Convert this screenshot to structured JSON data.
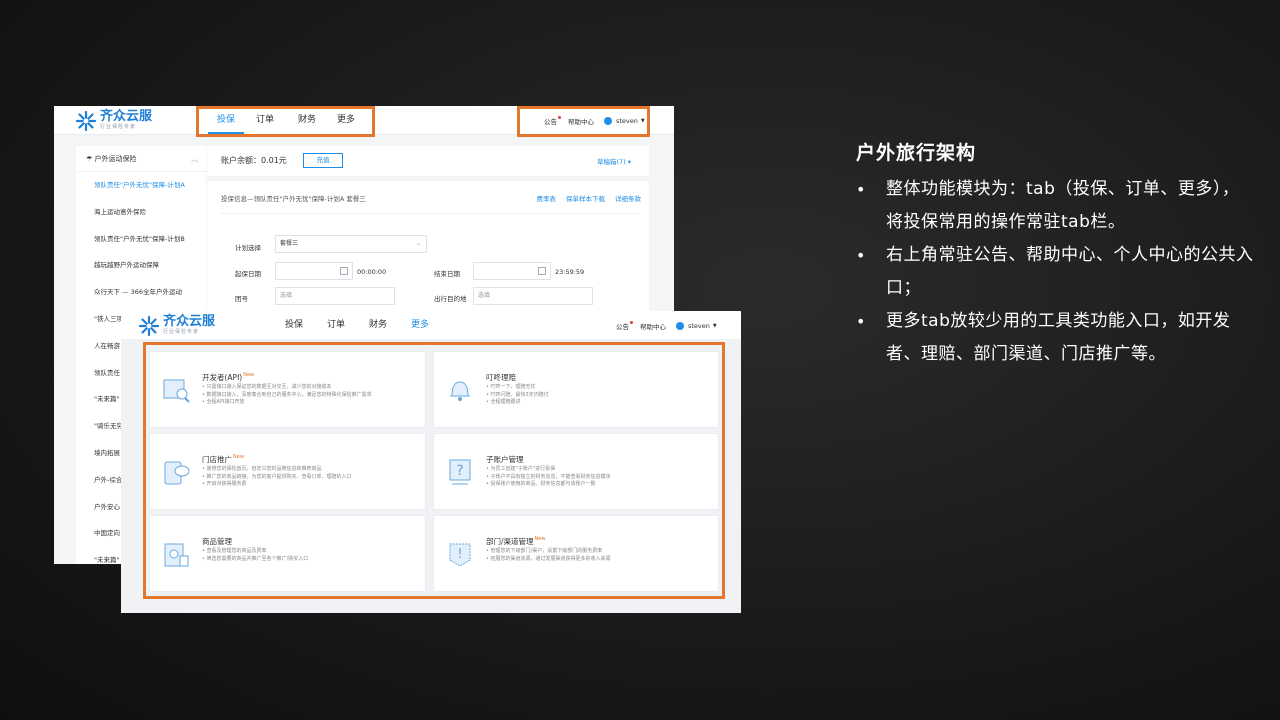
{
  "logo": {
    "name": "齐众云服",
    "slogan": "行业保险专家"
  },
  "nav_tabs": [
    "投保",
    "订单",
    "财务",
    "更多"
  ],
  "header_links": {
    "notice": "公告",
    "help": "帮助中心",
    "user": "steven"
  },
  "sidebar": {
    "heading": "户外运动保险",
    "items": [
      "领队责任\"户外无忧\"保障-计划A",
      "海上运动意外保险",
      "领队责任\"户外无忧\"保障-计划B",
      "越玩越野户外运动保障",
      "众行天下 — 366全年户外运动",
      "\"铁人三项",
      "人在畅游",
      "领队责任",
      "\"未来篇\"",
      "\"骑乐无穷",
      "境内拓展",
      "户外-综合",
      "户外安心",
      "中国定向",
      "\"未来篇\""
    ]
  },
  "account": {
    "balance": "账户余额：0.01元",
    "recharge": "充值",
    "drafts": "草稿箱(7)"
  },
  "form": {
    "breadcrumb": "投保信息—领队责任\"户外无忧\"保障-计划A 套餐三",
    "links": [
      "费率表",
      "保单样本下载",
      "详细条款"
    ],
    "plan_label": "计划选择",
    "plan_value": "套餐三",
    "start_label": "起保日期",
    "start_time": "00:00:00",
    "end_label": "结束日期",
    "end_time": "23:59:59",
    "group_label": "团号",
    "group_placeholder": "选填",
    "dest_label": "出行目的地",
    "dest_placeholder": "选填"
  },
  "more_cards": [
    {
      "title": "开发者(API)",
      "new": "New",
      "desc": [
        "• 只需接口接入保证您的数据互对交互，减少您的对接成本",
        "• 数据接口接入，深度奏合到自己的服务中心，满足您的特殊化保险推广需求",
        "• 全程API接口开放"
      ]
    },
    {
      "title": "叮咚理赔",
      "new": "",
      "desc": [
        "• 叮咚一下，理赔无忧",
        "• 叮咚闪赔，最快3天内赔付",
        "• 全程理赔跟进"
      ]
    },
    {
      "title": "门店推广",
      "new": "New",
      "desc": [
        "• 装修您的保险首页，自定义您的品牌信息和推荐商品",
        "• 推广您的商品链接，为您的客户提供购买、查看订单、理赔的入口",
        "• 开启对获得服务费"
      ]
    },
    {
      "title": "子账户管理",
      "new": "",
      "desc": [
        "• 为员工创建\"子账户\"进行投保",
        "• 子账户不具有独立的财务信息，不能查看财务信息模块",
        "• 投保账户使用的商品、财务信息都与该账户一致"
      ]
    },
    {
      "title": "商品管理",
      "new": "",
      "desc": [
        "• 查看及管理您的商品及费率",
        "• 筛选您需要的商品并推广至各个推广/购买入口"
      ]
    },
    {
      "title": "部门/渠道管理",
      "new": "New",
      "desc": [
        "• 管理您的下级部门/渠户，设置下级部门的服务费率",
        "• 拓展您的渠道资源，通过发展渠道获得更多的收入来源"
      ]
    }
  ],
  "panel": {
    "title": "户外旅行架构",
    "bullets": [
      "整体功能模块为：tab（投保、订单、更多），将投保常用的操作常驻tab栏。",
      "右上角常驻公告、帮助中心、个人中心的公共入口；",
      "更多tab放较少用的工具类功能入口，如开发者、理赔、部门渠道、门店推广等。"
    ]
  },
  "colors": {
    "accent": "#1f8ee6",
    "highlight": "#e4762e",
    "background": "#161616"
  },
  "icons": [
    "logo-mark-icon",
    "calendar-icon",
    "user-icon",
    "chevron-up-icon",
    "caret-down-icon",
    "api-icon",
    "bell-icon",
    "store-icon",
    "question-icon",
    "product-icon",
    "department-icon"
  ]
}
